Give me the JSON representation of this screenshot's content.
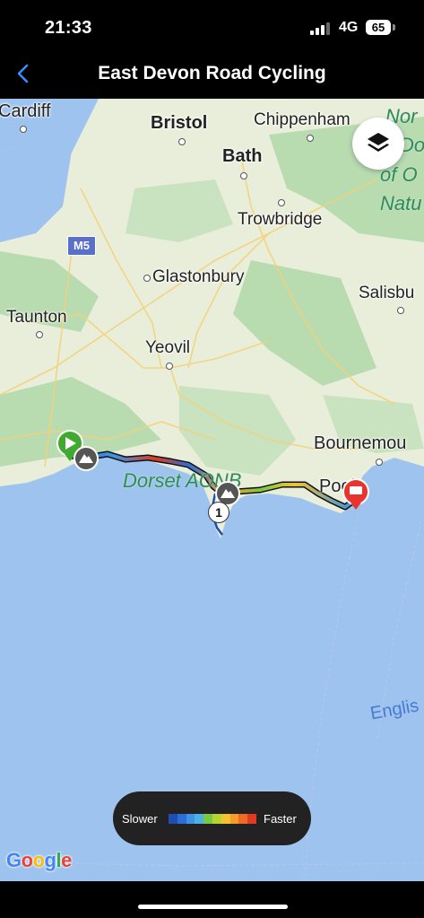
{
  "status_bar": {
    "time": "21:33",
    "network": "4G",
    "battery": "65"
  },
  "nav": {
    "title": "East Devon Road Cycling"
  },
  "map": {
    "places": {
      "cardiff": "Cardiff",
      "bristol": "Bristol",
      "chippenham": "Chippenham",
      "bath": "Bath",
      "trowbridge": "Trowbridge",
      "glastonbury": "Glastonbury",
      "salisbury": "Salisbu",
      "taunton": "Taunton",
      "yeovil": "Yeovil",
      "bournemouth": "Bournemou",
      "poole": "Poole"
    },
    "area_labels": {
      "north_wessex": [
        "Nor",
        "Do",
        "of O",
        "Natu"
      ],
      "dorset_aonb": "Dorset AONB",
      "english_channel": "Englis"
    },
    "road_shield": "M5",
    "waypoint_number": "1",
    "attribution": "Google"
  },
  "legend": {
    "slower_label": "Slower",
    "faster_label": "Faster",
    "colors": [
      "#1e4fb0",
      "#2b6ed8",
      "#3d93e6",
      "#4fb0e8",
      "#7ac943",
      "#b7d531",
      "#f2c230",
      "#f59a2b",
      "#ef6a25",
      "#e03a1f"
    ]
  },
  "colors": {
    "sea": "#9dc3ee",
    "land": "#e9eeda",
    "forest": "#b8dbb0",
    "start_marker": "#3faa2f",
    "end_marker": "#e8332f"
  }
}
